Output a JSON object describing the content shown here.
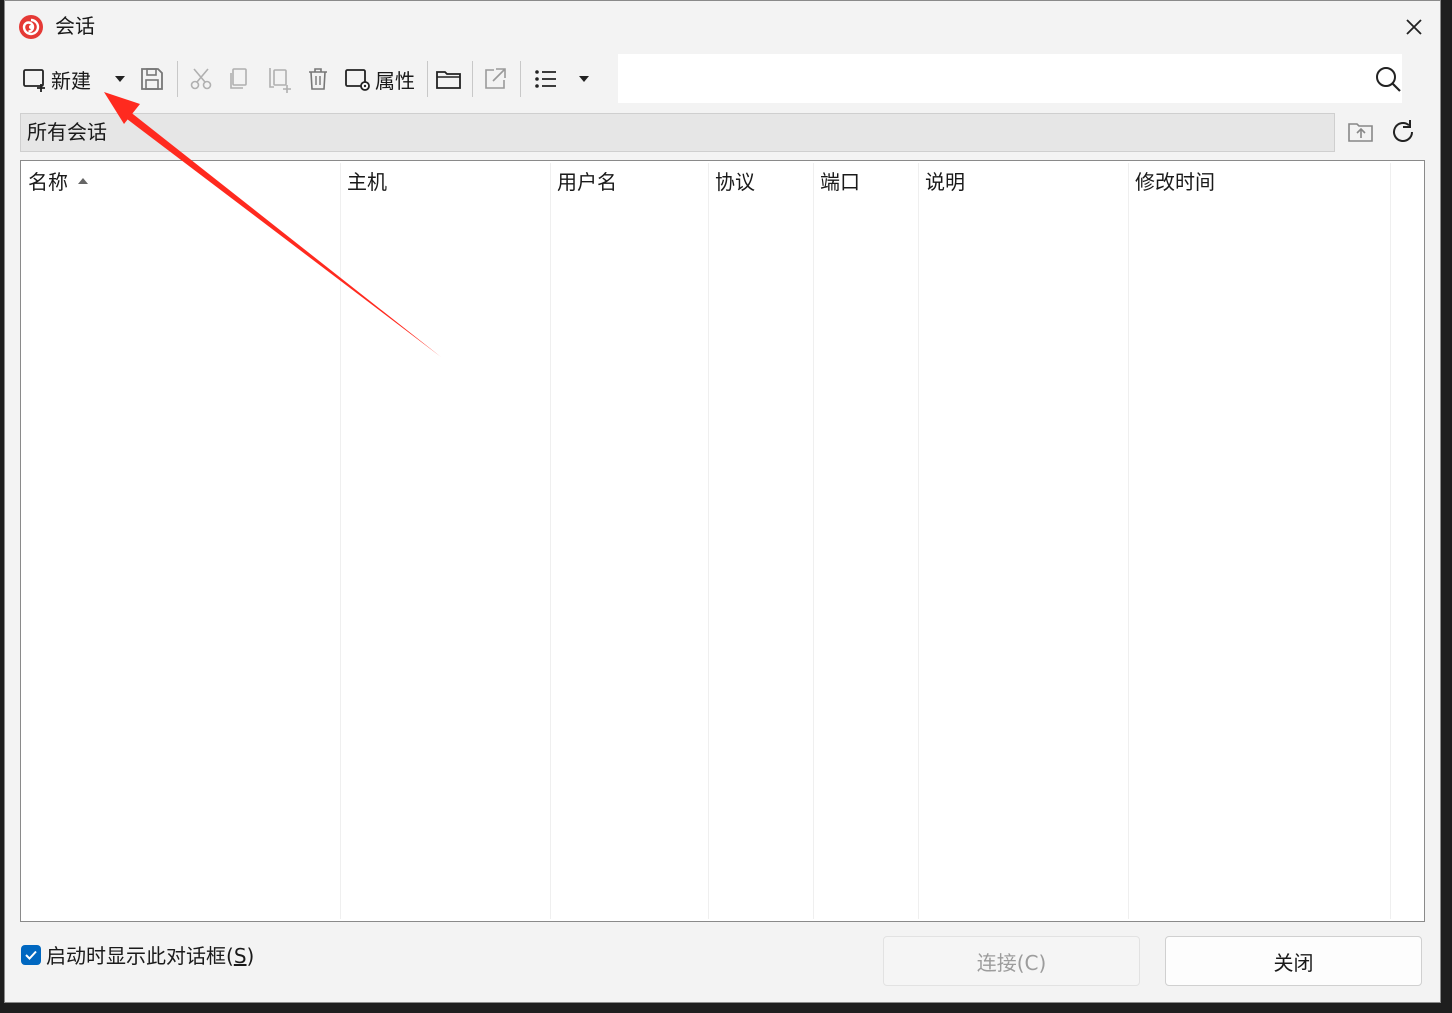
{
  "window": {
    "title": "会话",
    "logo_icon": "xshell-shell-logo",
    "logo_color": "#e53935"
  },
  "toolbar": {
    "new_label": "新建",
    "properties_label": "属性",
    "icons": [
      "new-session-icon",
      "dropdown-arrow-icon",
      "save-icon",
      "cut-icon",
      "copy-icon",
      "paste-icon",
      "delete-icon",
      "properties-icon",
      "open-folder-icon",
      "export-icon",
      "list-view-icon",
      "view-dropdown-icon"
    ]
  },
  "search": {
    "value": "",
    "icon": "search-icon"
  },
  "path": {
    "current": "所有会话"
  },
  "columns": [
    {
      "label": "名称",
      "sorted": "ascending"
    },
    {
      "label": "主机"
    },
    {
      "label": "用户名"
    },
    {
      "label": "协议"
    },
    {
      "label": "端口"
    },
    {
      "label": "说明"
    },
    {
      "label": "修改时间"
    }
  ],
  "rows": [],
  "footer": {
    "show_on_startup": {
      "label_prefix": "启动时显示此对话框(",
      "accelerator": "S",
      "label_suffix": ")",
      "checked": true
    },
    "connect_label": "连接(C)",
    "connect_enabled": false,
    "close_label": "关闭"
  },
  "annotation": {
    "type": "arrow",
    "color": "#ff2a1f"
  }
}
